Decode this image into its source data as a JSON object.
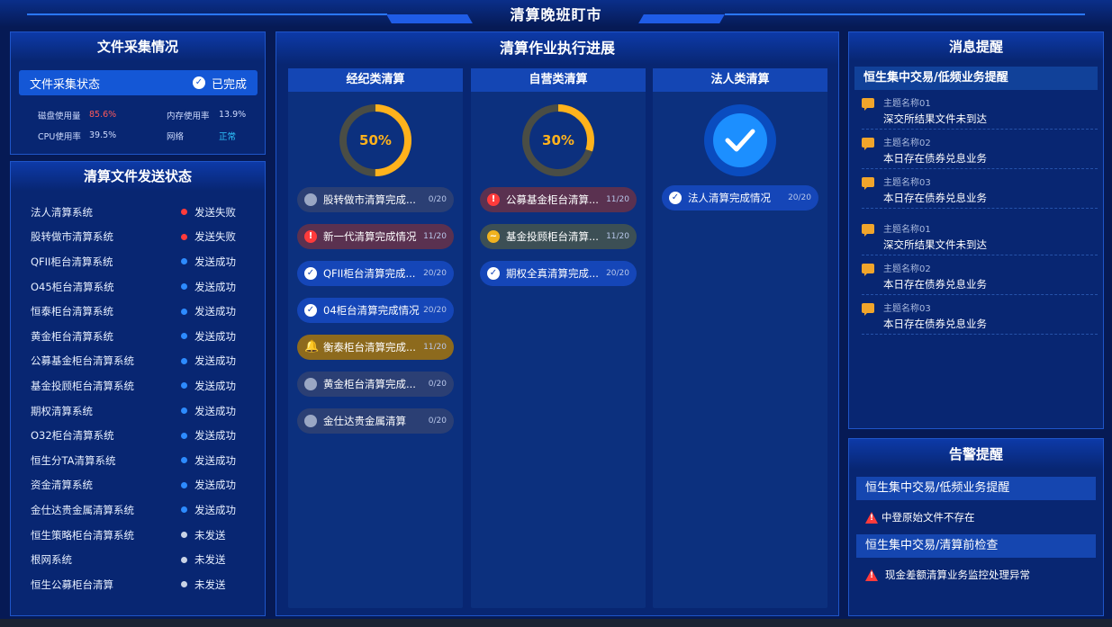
{
  "header": {
    "title": "清算晚班盯市"
  },
  "file_collect": {
    "title": "文件采集情况",
    "status_label": "文件采集状态",
    "status_value": "已完成",
    "stats": [
      {
        "label": "磁盘使用量",
        "value": "85.6%",
        "color": "#ff5a5a"
      },
      {
        "label": "内存使用率",
        "value": "13.9%",
        "color": "#cfdcff"
      },
      {
        "label": "CPU使用率",
        "value": "39.5%",
        "color": "#cfdcff"
      },
      {
        "label": "网络",
        "value": "正常",
        "color": "#2fc7ff"
      }
    ]
  },
  "send_status": {
    "title": "清算文件发送状态",
    "items": [
      {
        "name": "法人清算系统",
        "status": "发送失败",
        "state": "fail"
      },
      {
        "name": "股转做市清算系统",
        "status": "发送失败",
        "state": "fail"
      },
      {
        "name": "QFII柜台清算系统",
        "status": "发送成功",
        "state": "success"
      },
      {
        "name": "O45柜台清算系统",
        "status": "发送成功",
        "state": "success"
      },
      {
        "name": "恒泰柜台清算系统",
        "status": "发送成功",
        "state": "success"
      },
      {
        "name": "黄金柜台清算系统",
        "status": "发送成功",
        "state": "success"
      },
      {
        "name": "公募基金柜台清算系统",
        "status": "发送成功",
        "state": "success"
      },
      {
        "name": "基金投顾柜台清算系统",
        "status": "发送成功",
        "state": "success"
      },
      {
        "name": "期权清算系统",
        "status": "发送成功",
        "state": "success"
      },
      {
        "name": "O32柜台清算系统",
        "status": "发送成功",
        "state": "success"
      },
      {
        "name": "恒生分TA清算系统",
        "status": "发送成功",
        "state": "success"
      },
      {
        "name": "资金清算系统",
        "status": "发送成功",
        "state": "success"
      },
      {
        "name": "金仕达贵金属清算系统",
        "status": "发送成功",
        "state": "success"
      },
      {
        "name": "恒生策略柜台清算系统",
        "status": "未发送",
        "state": "pending"
      },
      {
        "name": "根网系统",
        "status": "未发送",
        "state": "pending"
      },
      {
        "name": "恒生公募柜台清算",
        "status": "未发送",
        "state": "pending"
      }
    ]
  },
  "progress": {
    "title": "清算作业执行进展",
    "columns": [
      {
        "title": "经纪类清算",
        "percent_label": "50%",
        "percent": 0.5,
        "tasks": [
          {
            "label": "股转做市清算完成...",
            "count": "0/20",
            "style": "grey"
          },
          {
            "label": "新一代清算完成情况",
            "count": "11/20",
            "style": "red"
          },
          {
            "label": "QFII柜台清算完成...",
            "count": "20/20",
            "style": "blue"
          },
          {
            "label": "04柜台清算完成情况",
            "count": "20/20",
            "style": "blue"
          },
          {
            "label": "衡泰柜台清算完成...",
            "count": "11/20",
            "style": "amber"
          },
          {
            "label": "黄金柜台清算完成...",
            "count": "0/20",
            "style": "grey"
          },
          {
            "label": "金仕达贵金属清算",
            "count": "0/20",
            "style": "grey"
          }
        ]
      },
      {
        "title": "自营类清算",
        "percent_label": "30%",
        "percent": 0.3,
        "tasks": [
          {
            "label": "公募基金柜台清算...",
            "count": "11/20",
            "style": "red"
          },
          {
            "label": "基金投顾柜台清算...",
            "count": "11/20",
            "style": "olive"
          },
          {
            "label": "期权全真清算完成...",
            "count": "20/20",
            "style": "blue"
          }
        ]
      },
      {
        "title": "法人类清算",
        "tasks": [
          {
            "label": "法人清算完成情况",
            "count": "20/20",
            "style": "blue"
          }
        ]
      }
    ]
  },
  "messages": {
    "title": "消息提醒",
    "group_title": "恒生集中交易/低频业务提醒",
    "items": [
      {
        "key": "主题名称01",
        "value": "深交所结果文件未到达"
      },
      {
        "key": "主题名称02",
        "value": "本日存在债券兑息业务"
      },
      {
        "key": "主题名称03",
        "value": "本日存在债券兑息业务"
      },
      {
        "key": "主题名称01",
        "value": "深交所结果文件未到达"
      },
      {
        "key": "主题名称02",
        "value": "本日存在债券兑息业务"
      },
      {
        "key": "主题名称03",
        "value": "本日存在债券兑息业务"
      }
    ]
  },
  "alerts": {
    "title": "告警提醒",
    "groups": [
      {
        "title": "恒生集中交易/低频业务提醒",
        "item": "中登原始文件不存在"
      },
      {
        "title": "恒生集中交易/清算前检查",
        "item": "现金差额清算业务监控处理异常"
      }
    ]
  },
  "colors": {
    "background": "#061a55",
    "panel": "#082672",
    "ring": "#ffb21c",
    "fail": "#ff3b3b",
    "success": "#2d8bff",
    "pending": "#c9d3e6"
  }
}
